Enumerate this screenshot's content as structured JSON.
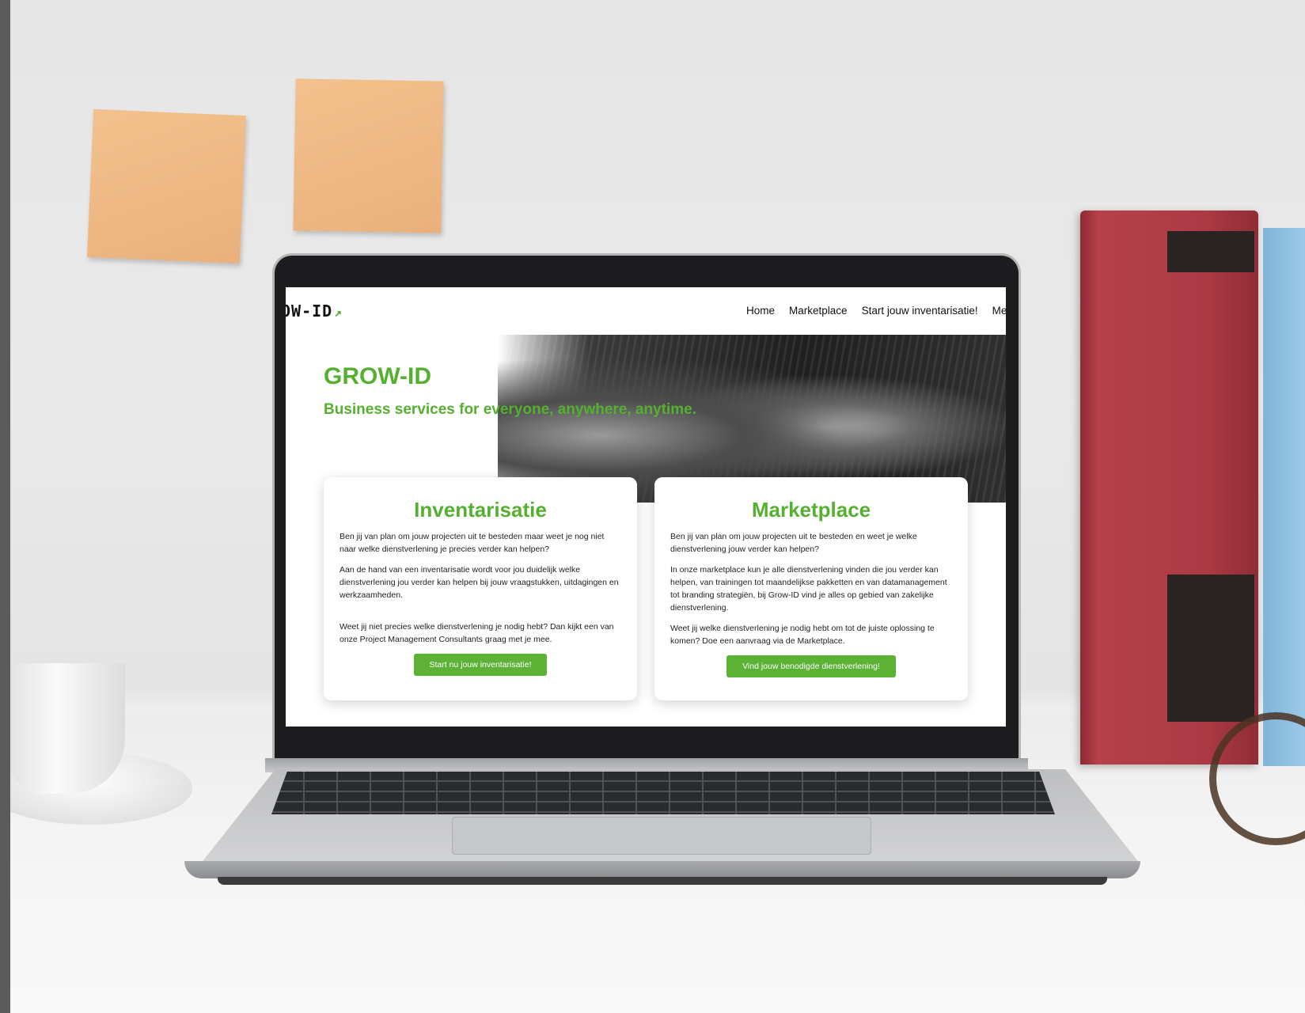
{
  "site": {
    "logo_text": "OW-ID",
    "nav": [
      "Home",
      "Marketplace",
      "Start jouw inventarisatie!",
      "Meer"
    ],
    "hero": {
      "title": "GROW-ID",
      "subtitle": "Business services for everyone, anywhere, anytime."
    },
    "cards": [
      {
        "title": "Inventarisatie",
        "paragraphs": [
          "Ben jij van plan om jouw projecten uit te besteden maar weet je nog niet naar welke dienstverlening je precies verder kan helpen?",
          "Aan de hand van een inventarisatie wordt voor jou duidelijk welke dienstverlening jou verder kan helpen bij jouw vraagstukken, uitdagingen en werkzaamheden.",
          "Weet jij niet precies welke dienstverlening je nodig hebt? Dan kijkt een van onze Project Management Consultants graag met je mee."
        ],
        "button": "Start nu jouw inventarisatie!"
      },
      {
        "title": "Marketplace",
        "paragraphs": [
          "Ben jij van plan om jouw projecten uit te besteden en weet je welke dienstverlening jouw verder kan helpen?",
          "In onze marketplace kun je alle dienstverlening vinden die jou verder kan helpen, van trainingen tot maandelijkse pakketten en van datamanagement tot branding strategiën, bij Grow-ID vind je alles op gebied van zakelijke dienstverlening.",
          "Weet jij welke dienstverlening je nodig hebt om tot de juiste oplossing te komen? Doe een aanvraag via de Marketplace."
        ],
        "button": "Vind jouw benodigde dienstverlening!"
      }
    ]
  },
  "colors": {
    "brand_green": "#55b030",
    "button_green": "#5bb234"
  }
}
